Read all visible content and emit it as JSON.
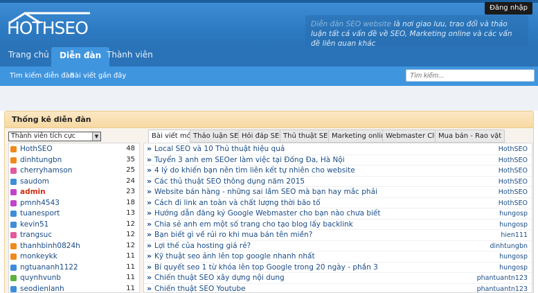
{
  "header": {
    "login_label": "Đăng nhập",
    "logo_text": "HOTHSEO",
    "tagline_highlight": "Diễn đàn SEO website",
    "tagline_rest": " là nơi giao lưu, trao đổi và thảo luận tất cả vấn đề về SEO, Marketing online và các vấn đề liên quan khác"
  },
  "nav": {
    "items": [
      {
        "label": "Trang chủ"
      },
      {
        "label": "Diễn đàn"
      },
      {
        "label": "Thành viên"
      }
    ]
  },
  "subnav": {
    "items": [
      {
        "label": "Tìm kiếm diễn đàn"
      },
      {
        "label": "Bài viết gần đây"
      }
    ],
    "search_placeholder": "Tìm kiếm..."
  },
  "stats": {
    "title": "Thống kê diễn đàn",
    "select_value": "Thành viên tích cực",
    "members": [
      {
        "name": "HothSEO",
        "count": "48",
        "color": "#f08a1c"
      },
      {
        "name": "dinhtungbn",
        "count": "35",
        "color": "#f08a1c"
      },
      {
        "name": "cherryhamson",
        "count": "25",
        "color": "#e25a9b"
      },
      {
        "name": "saudom",
        "count": "24",
        "color": "#3d8ed8"
      },
      {
        "name": "admin",
        "count": "23",
        "color": "#c045c9"
      },
      {
        "name": "pmnh4543",
        "count": "18",
        "color": "#c045c9"
      },
      {
        "name": "tuanesport",
        "count": "13",
        "color": "#3d8ed8"
      },
      {
        "name": "kevin51",
        "count": "12",
        "color": "#3d8ed8"
      },
      {
        "name": "trangsuc",
        "count": "12",
        "color": "#e25a9b"
      },
      {
        "name": "thanhbinh0824h",
        "count": "12",
        "color": "#f08a1c"
      },
      {
        "name": "monkeykk",
        "count": "11",
        "color": "#f08a1c"
      },
      {
        "name": "ngtuananh1122",
        "count": "11",
        "color": "#3d8ed8"
      },
      {
        "name": "quynhvunb",
        "count": "11",
        "color": "#5cb33a"
      },
      {
        "name": "seodienlanh",
        "count": "11",
        "color": "#3d8ed8"
      }
    ],
    "tabs": [
      {
        "label": "Bài viết mới"
      },
      {
        "label": "Thảo luận SEO"
      },
      {
        "label": "Hỏi đáp SEO"
      },
      {
        "label": "Thủ thuật SEO"
      },
      {
        "label": "Marketing online"
      },
      {
        "label": "Webmaster Club"
      },
      {
        "label": "Mua bán - Rao vặt"
      }
    ],
    "topics": [
      {
        "title": "Local SEO và 10 Thủ thuật hiệu quả",
        "author": "HothSEO"
      },
      {
        "title": "Tuyển 3 anh em SEOer làm việc tại Đống Đa, Hà Nội",
        "author": "HothSEO"
      },
      {
        "title": "4 lý do khiến bạn nên tìm liên kết tự nhiên cho website",
        "author": "HothSEO"
      },
      {
        "title": "Các thủ thuật SEO thông dụng năm 2015",
        "author": "HothSEO"
      },
      {
        "title": "Website bán hàng - những sai lầm SEO mà bạn hay mắc phải",
        "author": "HothSEO"
      },
      {
        "title": "Cách đi link an toàn và chất lượng thời bão tố",
        "author": "HothSEO"
      },
      {
        "title": "Hướng dẫn đăng ký Google Webmaster cho bạn nào chưa biết",
        "author": "hungosp"
      },
      {
        "title": "Chia sẻ anh em một số trang cho tạo blog lấy backlink",
        "author": "hungosp"
      },
      {
        "title": "Bạn biết gì về rủi ro khi mua bán tên miền?",
        "author": "hien111"
      },
      {
        "title": "Lợi thế của hosting giá rẻ?",
        "author": "dinhtungbn"
      },
      {
        "title": "Kỹ thuật seo ảnh lên top google nhanh nhất",
        "author": "hungosp"
      },
      {
        "title": "Bí quyết seo 1 từ khóa lên top Google trong 20 ngày - phần 3",
        "author": "hungosp"
      },
      {
        "title": "Chiến thuật SEO xây dựng nội dung",
        "author": "phantuantn123"
      },
      {
        "title": "Chiến thuật SEO Youtube",
        "author": "phantuantn123"
      }
    ]
  }
}
